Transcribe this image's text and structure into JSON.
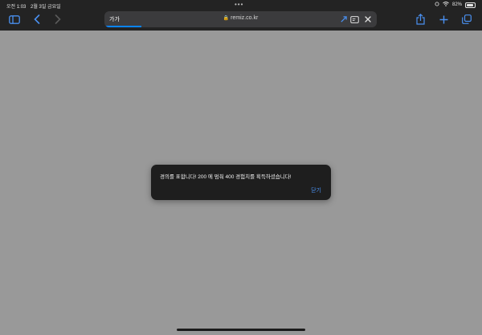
{
  "status_bar": {
    "time": "오전 1:03",
    "date": "2월 3일 금요일",
    "battery": "82%"
  },
  "browser": {
    "typed_text": "가가",
    "host": "remiz.co.kr",
    "accent_color": "#0a84ff",
    "icons": [
      "sidebar-icon",
      "back-icon",
      "forward-icon",
      "puzzle-icon",
      "reader-icon",
      "close-icon",
      "share-icon",
      "new-tab-icon",
      "tabs-icon"
    ]
  },
  "alert": {
    "message": "경의를 표합니다! 200 에 멈춰 400 경험치를 획득하셨습니다!",
    "close_label": "닫기"
  }
}
